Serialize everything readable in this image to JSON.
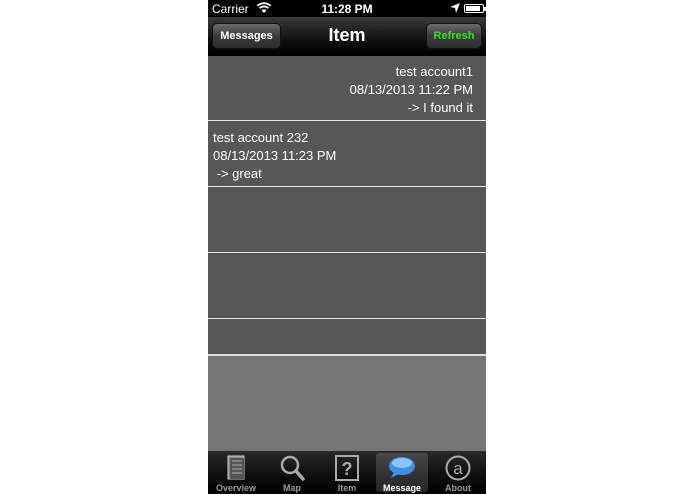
{
  "status_bar": {
    "carrier": "Carrier",
    "time": "11:28 PM",
    "battery_level": 0.9,
    "icons": [
      "wifi-icon",
      "location-arrow-icon",
      "battery-icon"
    ]
  },
  "nav": {
    "title": "Item",
    "back_label": "Messages",
    "refresh_label": "Refresh"
  },
  "colors": {
    "refresh_text": "#2fe62f",
    "row_background": "#575757",
    "empty_background": "#757575"
  },
  "messages": [
    {
      "account": "test account1",
      "timestamp": "08/13/2013 11:22 PM",
      "text": "-> I found it",
      "align": "right"
    },
    {
      "account": "test account 232",
      "timestamp": "08/13/2013 11:23 PM",
      "text": " -> great",
      "align": "left"
    }
  ],
  "tabs": [
    {
      "label": "Overview",
      "icon": "book-icon"
    },
    {
      "label": "Map",
      "icon": "magnifier-icon"
    },
    {
      "label": "Item",
      "icon": "question-box-icon"
    },
    {
      "label": "Message",
      "icon": "speech-bubble-icon",
      "active": true
    },
    {
      "label": "About",
      "icon": "at-sign-icon"
    }
  ]
}
